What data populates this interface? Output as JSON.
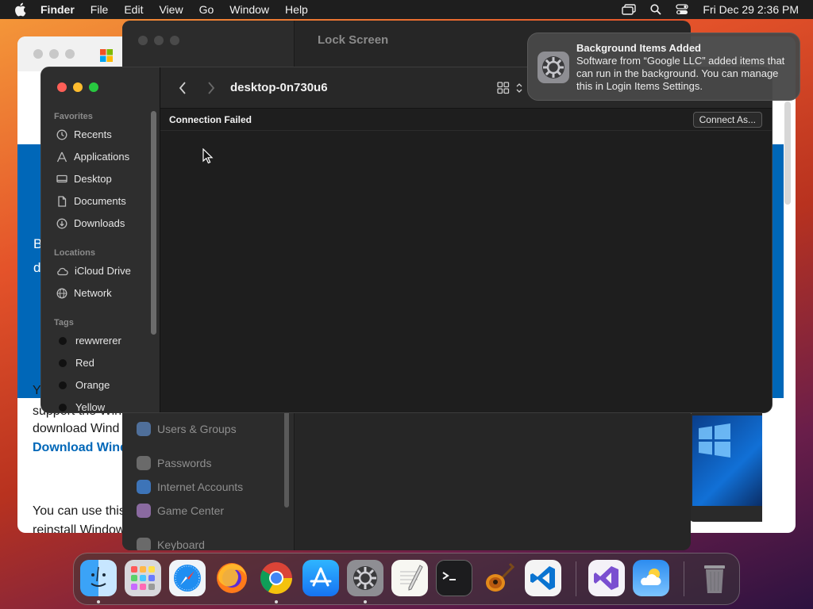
{
  "menubar": {
    "app_name": "Finder",
    "menus": [
      "File",
      "Edit",
      "View",
      "Go",
      "Window",
      "Help"
    ],
    "clock": "Fri Dec 29  2:36 PM"
  },
  "background_windows": {
    "system_settings": {
      "title": "Lock Screen",
      "sidebar_items": [
        "Users & Groups",
        "Passwords",
        "Internet Accounts",
        "Game Center",
        "Keyboard"
      ]
    },
    "microsoft_page": {
      "fragments": [
        "B",
        "d",
        "Y",
        "support the Win",
        "download Wind",
        "Download Wind",
        "You can use this",
        "reinstall Window"
      ]
    }
  },
  "notification": {
    "title": "Background Items Added",
    "body": "Software from “Google LLC” added items that can run in the background. You can manage this in Login Items Settings."
  },
  "finder": {
    "title": "desktop-0n730u6",
    "sections": {
      "favorites": "Favorites",
      "locations": "Locations",
      "tags": "Tags"
    },
    "favorites": [
      "Recents",
      "Applications",
      "Desktop",
      "Documents",
      "Downloads"
    ],
    "locations": [
      "iCloud Drive",
      "Network"
    ],
    "tags": [
      "rewwrerer",
      "Red",
      "Orange",
      "Yellow"
    ],
    "status": "Connection Failed",
    "connect_button": "Connect As..."
  },
  "dock": {
    "apps": [
      "Finder",
      "Launchpad",
      "Safari",
      "Firefox",
      "Chrome",
      "App Store",
      "System Settings",
      "TextEdit",
      "Terminal",
      "GarageBand",
      "Visual Studio Code",
      "Visual Studio",
      "Weather",
      "Trash"
    ]
  },
  "colors": {
    "close": "#ff5f57",
    "minimize": "#febc2e",
    "zoom": "#28c840",
    "ms_blue": "#0067b8"
  }
}
